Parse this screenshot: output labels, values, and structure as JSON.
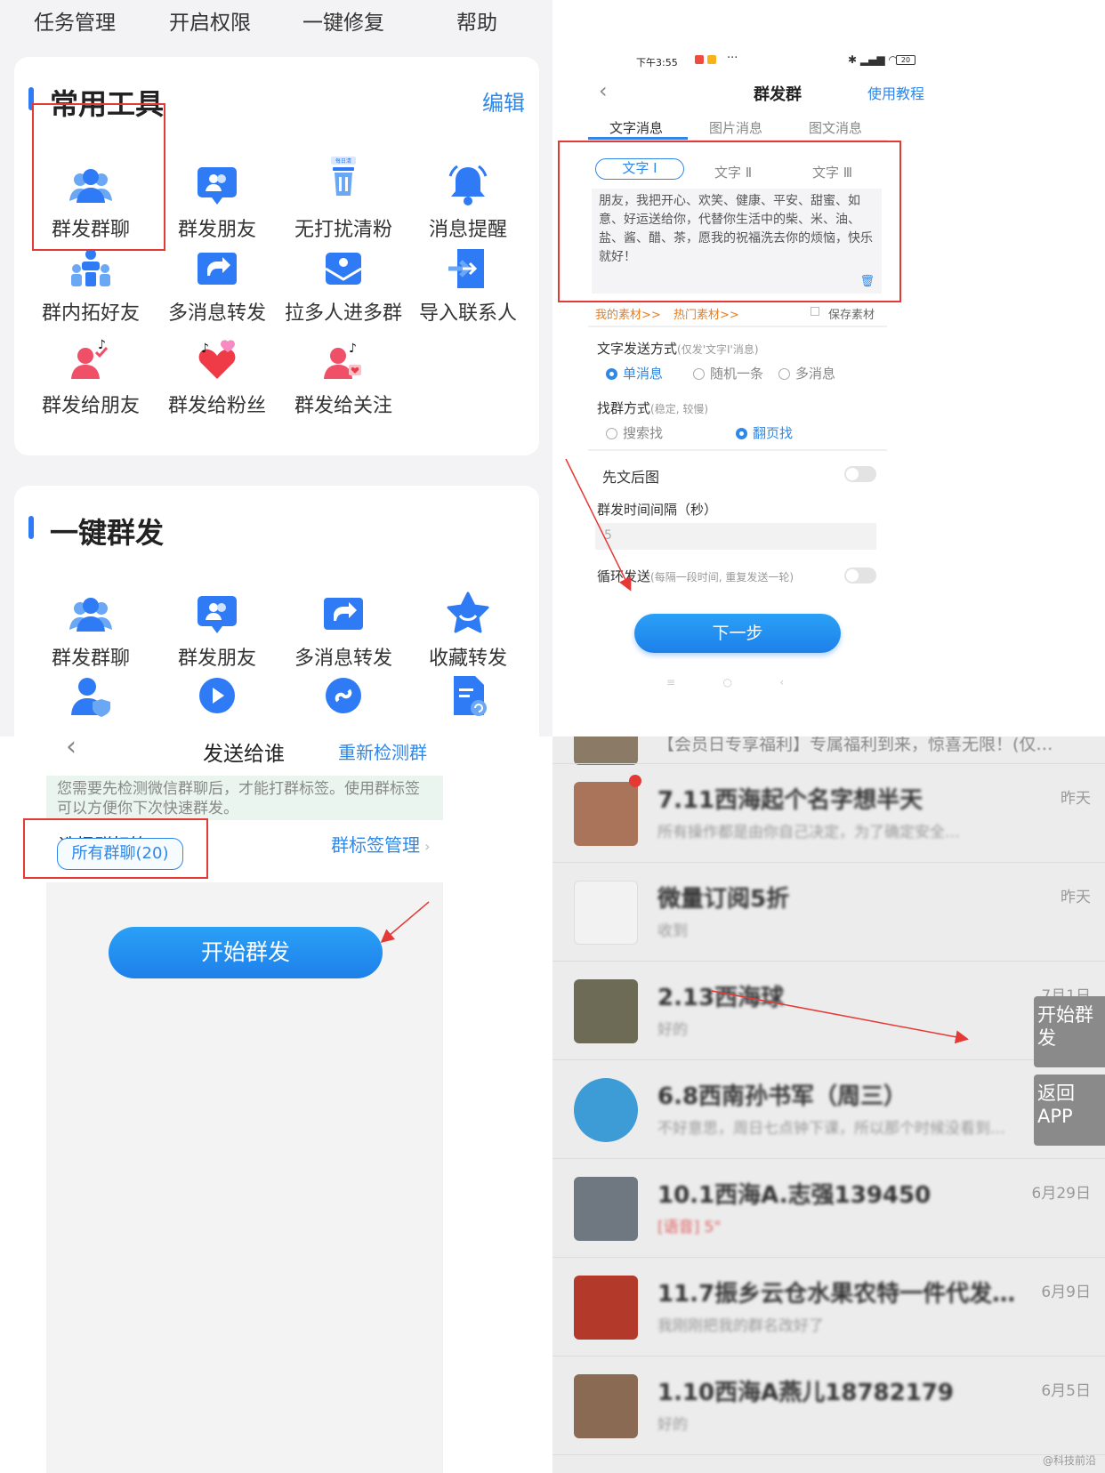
{
  "tools_panel": {
    "top_nav": [
      "任务管理",
      "开启权限",
      "一键修复",
      "帮助"
    ],
    "common_tools": {
      "title": "常用工具",
      "edit": "编辑",
      "items": [
        {
          "label": "群发群聊",
          "icon": "group-users-icon"
        },
        {
          "label": "群发朋友",
          "icon": "friend-card-icon"
        },
        {
          "label": "无打扰清粉",
          "icon": "trash-can-icon",
          "badge": "每日清"
        },
        {
          "label": "消息提醒",
          "icon": "bell-icon"
        },
        {
          "label": "群内拓好友",
          "icon": "group-meeting-icon"
        },
        {
          "label": "多消息转发",
          "icon": "forward-share-icon"
        },
        {
          "label": "拉多人进多群",
          "icon": "envelope-group-icon"
        },
        {
          "label": "导入联系人",
          "icon": "import-door-icon"
        },
        {
          "label": "群发给朋友",
          "icon": "tiktok-user-check-icon"
        },
        {
          "label": "群发给粉丝",
          "icon": "tiktok-heart-icon"
        },
        {
          "label": "群发给关注",
          "icon": "tiktok-user-heart-icon"
        }
      ]
    },
    "one_click": {
      "title": "一键群发",
      "items": [
        {
          "label": "群发群聊",
          "icon": "group-users-icon"
        },
        {
          "label": "群发朋友",
          "icon": "friend-card-icon"
        },
        {
          "label": "多消息转发",
          "icon": "forward-share-icon"
        },
        {
          "label": "收藏转发",
          "icon": "star-smile-icon"
        },
        {
          "label": "",
          "icon": "user-shield-icon"
        },
        {
          "label": "",
          "icon": "play-circle-icon"
        },
        {
          "label": "",
          "icon": "link-circle-icon"
        },
        {
          "label": "",
          "icon": "document-refresh-icon"
        }
      ]
    }
  },
  "settings_panel": {
    "status_time": "下午3:55",
    "status_dots": "···",
    "battery": "20",
    "title": "群发群",
    "tutorial": "使用教程",
    "tabs": [
      "文字消息",
      "图片消息",
      "图文消息"
    ],
    "subtabs": [
      "文字 Ⅰ",
      "文字 Ⅱ",
      "文字 Ⅲ"
    ],
    "message": "朋友，我把开心、欢笑、健康、平安、甜蜜、如意、好运送给你，代替你生活中的柴、米、油、盐、酱、醋、茶，愿我的祝福洗去你的烦恼，快乐就好！",
    "my_material": "我的素材>>",
    "hot_material": "热门素材>>",
    "save_material": "保存素材",
    "send_mode_label": "文字发送方式",
    "send_mode_hint": "(仅发'文字Ⅰ'消息)",
    "send_mode_options": [
      "单消息",
      "随机一条",
      "多消息"
    ],
    "find_group_label": "找群方式",
    "find_group_hint": "(稳定, 较慢)",
    "find_group_options": [
      "搜索找",
      "翻页找"
    ],
    "text_first": "先文后图",
    "interval_label": "群发时间间隔（秒）",
    "interval_value": "5",
    "loop_label": "循环发送",
    "loop_hint": "(每隔一段时间, 重复发送一轮)",
    "next_button": "下一步"
  },
  "send_panel": {
    "title": "发送给谁",
    "recheck": "重新检测群",
    "notice": "您需要先检测微信群聊后，才能打群标签。使用群标签可以方便你下次快速群发。",
    "choose_tag": "选择群标签",
    "tag_manage": "群标签管理",
    "tag_chip": "所有群聊(20)",
    "start_button": "开始群发"
  },
  "chat_panel": {
    "top_partial": "【会员日专享福利】专属福利到来，惊喜无限！(仅…",
    "rows": [
      {
        "name": "7.11西海起个名字想半天",
        "msg": "所有操作都是由你自己决定，为了确定安全…",
        "time": "昨天",
        "avatar_color": "#a9745a"
      },
      {
        "name": "微量订阅5折",
        "msg": "收到",
        "time": "昨天",
        "avatar_color": "#f2f2f2"
      },
      {
        "name": "2.13西海球",
        "msg": "好的",
        "time": "7月1日",
        "avatar_color": "#6d6a55"
      },
      {
        "name": "6.8西南孙书军（周三）",
        "msg": "不好意思，周日七点钟下课，所以那个时候没看到…",
        "time": "",
        "avatar_color": "#3d9bd6"
      },
      {
        "name": "10.1西海A.志强139450",
        "msg": "[语音] 5\"",
        "time": "6月29日",
        "avatar_color": "#6f7780"
      },
      {
        "name": "11.7振乡云仓水果农特一件代发…",
        "msg": "我刚刚把我的群名改好了",
        "time": "6月9日",
        "avatar_color": "#b33a2a"
      },
      {
        "name": "1.10西海A燕儿18782179",
        "msg": "好的",
        "time": "6月5日",
        "avatar_color": "#8a6a52"
      }
    ],
    "float_start": "开始群发",
    "float_return": "返回APP",
    "watermark": "@科技前沿"
  }
}
